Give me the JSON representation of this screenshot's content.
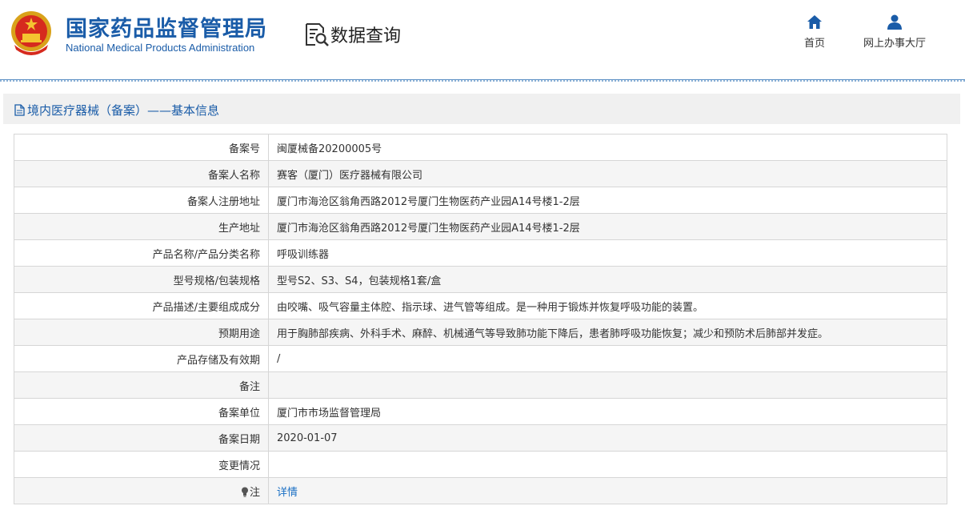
{
  "header": {
    "brand_cn": "国家药品监督管理局",
    "brand_en": "National Medical Products Administration",
    "query_title": "数据查询",
    "nav": [
      {
        "label": "首页",
        "icon": "home-icon"
      },
      {
        "label": "网上办事大厅",
        "icon": "user-icon"
      }
    ]
  },
  "panel": {
    "title": "境内医疗器械（备案）——基本信息"
  },
  "rows": [
    {
      "label": "备案号",
      "value": "闽厦械备20200005号"
    },
    {
      "label": "备案人名称",
      "value": "赛客（厦门）医疗器械有限公司"
    },
    {
      "label": "备案人注册地址",
      "value": "厦门市海沧区翁角西路2012号厦门生物医药产业园A14号楼1-2层"
    },
    {
      "label": "生产地址",
      "value": "厦门市海沧区翁角西路2012号厦门生物医药产业园A14号楼1-2层"
    },
    {
      "label": "产品名称/产品分类名称",
      "value": "呼吸训练器"
    },
    {
      "label": "型号规格/包装规格",
      "value": "型号S2、S3、S4，包装规格1套/盒"
    },
    {
      "label": "产品描述/主要组成成分",
      "value": "由咬嘴、吸气容量主体腔、指示球、进气管等组成。是一种用于锻炼并恢复呼吸功能的装置。"
    },
    {
      "label": "预期用途",
      "value": "用于胸肺部疾病、外科手术、麻醉、机械通气等导致肺功能下降后，患者肺呼吸功能恢复；减少和预防术后肺部并发症。"
    },
    {
      "label": "产品存储及有效期",
      "value": "/"
    },
    {
      "label": "备注",
      "value": ""
    },
    {
      "label": "备案单位",
      "value": "厦门市市场监督管理局"
    },
    {
      "label": "备案日期",
      "value": "2020-01-07"
    },
    {
      "label": "变更情况",
      "value": ""
    },
    {
      "label": "注",
      "value": "详情"
    }
  ],
  "colors": {
    "brand": "#1a5ca8",
    "link": "#1a6fc4"
  }
}
